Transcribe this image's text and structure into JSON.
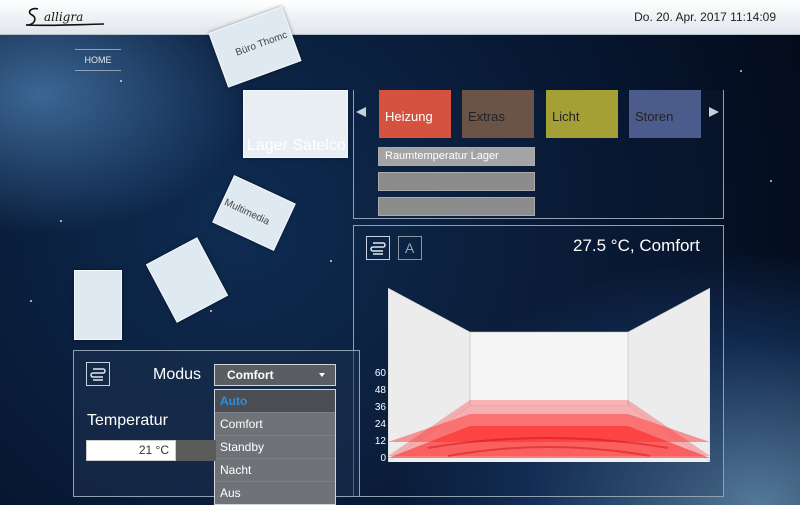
{
  "header": {
    "datetime": "Do. 20. Apr. 2017 11:14:09"
  },
  "nav": {
    "home_label": "HOME"
  },
  "rooms": [
    {
      "label": "Büro Thomc"
    },
    {
      "label": "Lager Satelco"
    },
    {
      "label": "Multimedia"
    },
    {
      "label": ""
    },
    {
      "label": ""
    }
  ],
  "categories": [
    {
      "label": "Heizung",
      "color": "#d4523e"
    },
    {
      "label": "Extras",
      "color": "#6a5347"
    },
    {
      "label": "Licht",
      "color": "#a5a035"
    },
    {
      "label": "Storen",
      "color": "#4b5b8c"
    }
  ],
  "subitems": [
    {
      "label": "Raumtemperatur Lager"
    },
    {
      "label": ""
    },
    {
      "label": ""
    }
  ],
  "visual": {
    "temperature_display": "27.5 °C, Comfort",
    "mode_letter": "A",
    "y_ticks": [
      "60",
      "48",
      "36",
      "24",
      "12",
      "0"
    ]
  },
  "control": {
    "modus_label": "Modus",
    "modus_selected": "Comfort",
    "modus_options": [
      "Auto",
      "Comfort",
      "Standby",
      "Nacht",
      "Aus"
    ],
    "modus_highlighted": "Auto",
    "temperature_label": "Temperatur",
    "temperature_value": "21 °C"
  }
}
